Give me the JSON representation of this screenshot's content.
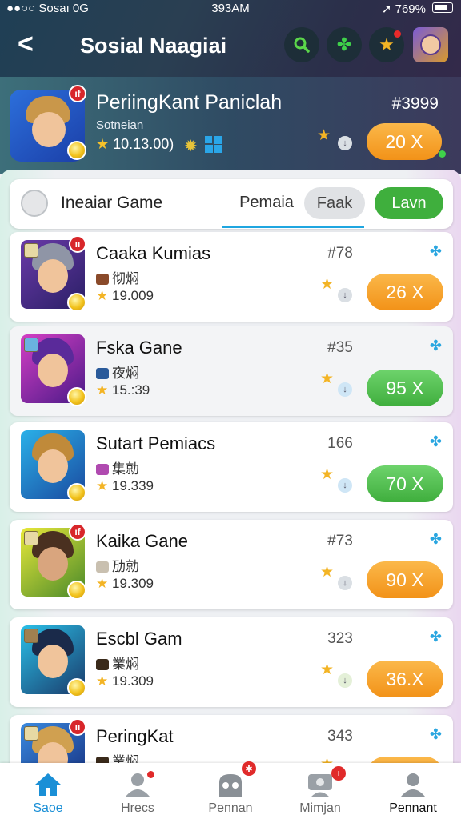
{
  "status_bar": {
    "carrier": "●●○○ Sosaı 0G",
    "time": "393AM",
    "battery": "769%"
  },
  "header": {
    "back_glyph": "<",
    "title": "Sosial Naagiai"
  },
  "featured": {
    "title": "PeriingKant Paniclah",
    "subtitle": "Sotneian",
    "rating": "10.13.00)",
    "price": "#3999",
    "badge": "ıf",
    "action_label": "20 X"
  },
  "tab_bar": {
    "title": "Ineaiar Game",
    "tabs": [
      "Pemaia",
      "Faak",
      "Lavn"
    ]
  },
  "cards": [
    {
      "name": "Caaka Kumias",
      "subtitle": "彻焖",
      "rating": "19.009",
      "number": "#78",
      "badge": "ıı",
      "action": "26 X",
      "color": "orange"
    },
    {
      "name": "Fska Gane",
      "subtitle": "夜焖",
      "rating": "15.:39",
      "number": "#35",
      "badge": "",
      "action": "95 X",
      "color": "green"
    },
    {
      "name": "Sutart Pemiacs",
      "subtitle": "集勍",
      "rating": "19.339",
      "number": "166",
      "badge": "",
      "action": "70 X",
      "color": "green"
    },
    {
      "name": "Kaika Gane",
      "subtitle": "劢勍",
      "rating": "19.309",
      "number": "#73",
      "badge": "ıf",
      "action": "90 X",
      "color": "orange"
    },
    {
      "name": "Escbl Gam",
      "subtitle": "業焖",
      "rating": "19.309",
      "number": "323",
      "badge": "",
      "action": "36.X",
      "color": "orange"
    },
    {
      "name": "PeringKat",
      "subtitle": "業焖",
      "rating": "",
      "number": "343",
      "badge": "ıı",
      "action": "",
      "color": "orange"
    }
  ],
  "bottom_nav": [
    {
      "label": "Saoe",
      "icon": "home-icon",
      "active": true
    },
    {
      "label": "Hrecs",
      "icon": "person-icon"
    },
    {
      "label": "Pennan",
      "icon": "robot-icon",
      "badge": "✱"
    },
    {
      "label": "Mimjan",
      "icon": "chat-person-icon",
      "badge": "ı"
    },
    {
      "label": "Pennant",
      "icon": "profile-icon"
    }
  ],
  "colors": {
    "orange": "#f29218",
    "green": "#3fae3d",
    "accent": "#1a8fd6"
  }
}
